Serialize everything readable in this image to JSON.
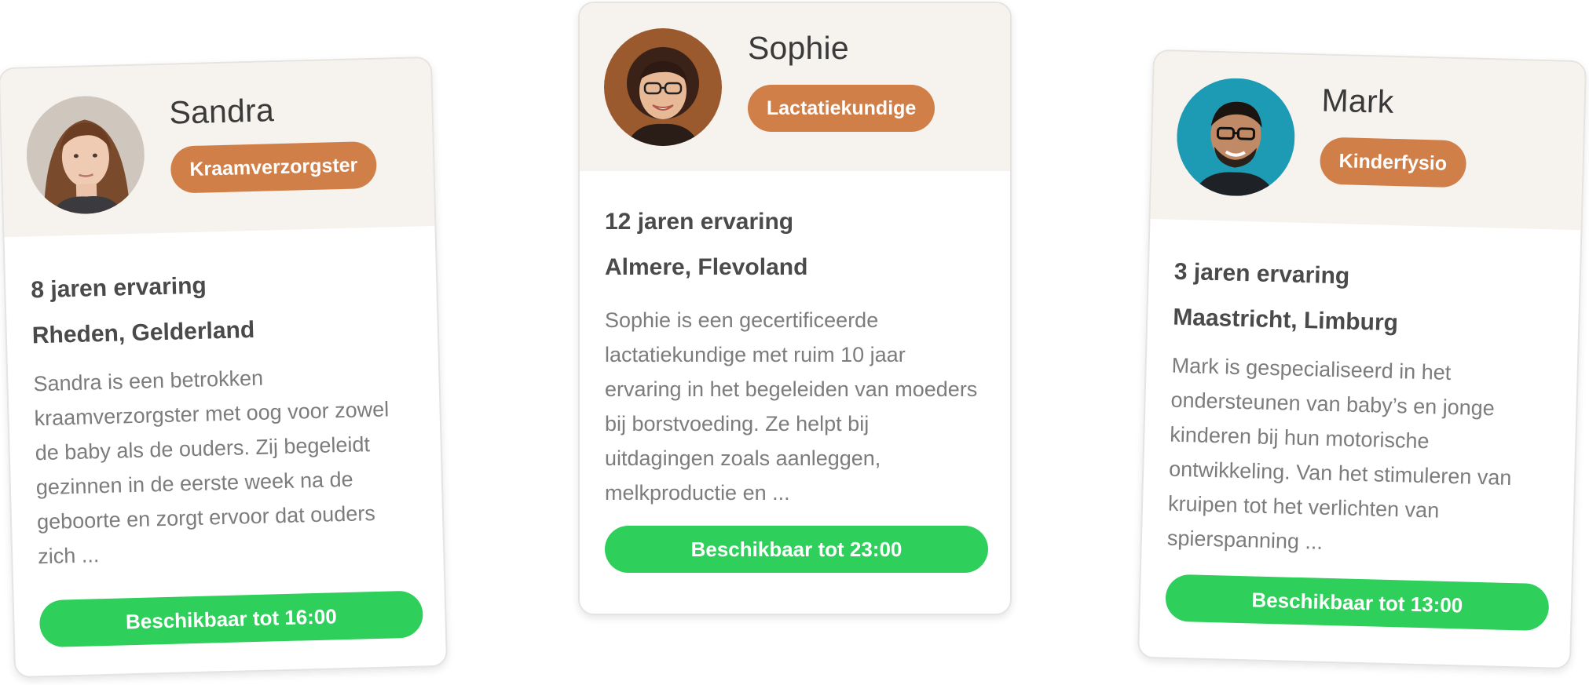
{
  "colors": {
    "header_bg": "#f6f2ee",
    "role_badge": "#d17f48",
    "available_button": "#2ecf5a",
    "heading_text": "#4a4a4a",
    "body_text": "#7c7c7c"
  },
  "cards": [
    {
      "name": "Sandra",
      "role": "Kraamverzorgster",
      "experience": "8 jaren ervaring",
      "location": "Rheden, Gelderland",
      "description": "Sandra is een betrokken kraamverzorgster met oog voor zowel de baby als de ouders. Zij begeleidt gezinnen in de eerste week na de geboorte en zorgt ervoor dat ouders zich ...",
      "availability": "Beschikbaar tot 16:00",
      "avatar_icon": "woman-portrait-icon"
    },
    {
      "name": "Sophie",
      "role": "Lactatiekundige",
      "experience": "12 jaren ervaring",
      "location": "Almere, Flevoland",
      "description": "Sophie is een gecertificeerde lactatiekundige met ruim 10 jaar ervaring in het begeleiden van moeders bij borstvoeding. Ze helpt bij uitdagingen zoals aanleggen, melkproductie en ...",
      "availability": "Beschikbaar tot 23:00",
      "avatar_icon": "woman-glasses-portrait-icon"
    },
    {
      "name": "Mark",
      "role": "Kinderfysio",
      "experience": "3 jaren ervaring",
      "location": "Maastricht, Limburg",
      "description": "Mark is gespecialiseerd in het ondersteunen van baby’s en jonge kinderen bij hun motorische ontwikkeling. Van het stimuleren van kruipen tot het verlichten van spierspanning ...",
      "availability": "Beschikbaar tot 13:00",
      "avatar_icon": "man-glasses-portrait-icon"
    }
  ]
}
